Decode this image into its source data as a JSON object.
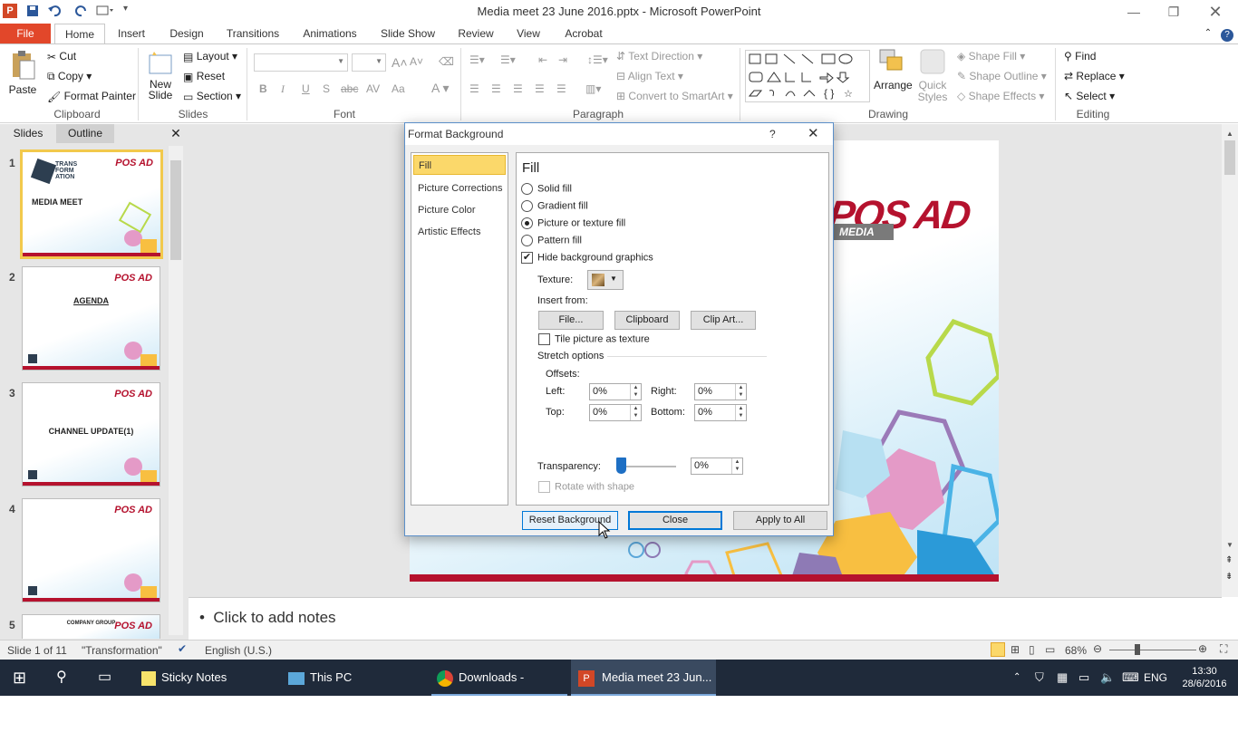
{
  "window": {
    "title": "Media meet  23 June 2016.pptx - Microsoft PowerPoint",
    "app_icon": "powerpoint-icon"
  },
  "tabs": [
    "File",
    "Home",
    "Insert",
    "Design",
    "Transitions",
    "Animations",
    "Slide Show",
    "Review",
    "View",
    "Acrobat"
  ],
  "ribbon": {
    "clipboard": {
      "paste": "Paste",
      "cut": "Cut",
      "copy": "Copy",
      "format_painter": "Format Painter",
      "label": "Clipboard"
    },
    "slides": {
      "new_slide_1": "New",
      "new_slide_2": "Slide",
      "layout": "Layout",
      "reset": "Reset",
      "section": "Section",
      "label": "Slides"
    },
    "font": {
      "label": "Font",
      "bold": "B",
      "italic": "I",
      "underline": "U",
      "strike": "abc",
      "shadow": "S"
    },
    "paragraph": {
      "text_direction": "Text Direction",
      "align_text": "Align Text",
      "convert_smartart": "Convert to SmartArt",
      "label": "Paragraph"
    },
    "drawing": {
      "arrange": "Arrange",
      "quick_styles_1": "Quick",
      "quick_styles_2": "Styles",
      "shape_fill": "Shape Fill",
      "shape_outline": "Shape Outline",
      "shape_effects": "Shape Effects",
      "label": "Drawing"
    },
    "editing": {
      "find": "Find",
      "replace": "Replace",
      "select": "Select",
      "label": "Editing"
    }
  },
  "left_pane": {
    "tabs": [
      "Slides",
      "Outline"
    ],
    "thumbnails": [
      {
        "num": "1",
        "title": "MEDIA MEET",
        "sub": "TRANS FORM ATION",
        "logo": "POS AD"
      },
      {
        "num": "2",
        "title": "AGENDA",
        "logo": "POS AD"
      },
      {
        "num": "3",
        "title": "CHANNEL UPDATE(1)",
        "logo": "POS AD"
      },
      {
        "num": "4",
        "title": "",
        "logo": "POS AD"
      },
      {
        "num": "5",
        "title": "COMPANY GROUP",
        "logo": "POS AD"
      }
    ]
  },
  "slide": {
    "logo_main": "POS AD",
    "logo_sub": "MEDIA"
  },
  "notes": {
    "placeholder": "Click to add notes"
  },
  "dialog": {
    "title": "Format Background",
    "help": "?",
    "nav": [
      "Fill",
      "Picture Corrections",
      "Picture Color",
      "Artistic Effects"
    ],
    "heading": "Fill",
    "options": {
      "solid_fill": "Solid fill",
      "gradient_fill": "Gradient fill",
      "picture_fill": "Picture or texture fill",
      "pattern_fill": "Pattern fill",
      "hide_bg": "Hide background graphics"
    },
    "selected_option": "picture_fill",
    "texture_label": "Texture:",
    "insert_from_label": "Insert from:",
    "file_btn": "File...",
    "clipboard_btn": "Clipboard",
    "clipart_btn": "Clip Art...",
    "tile_label": "Tile picture as texture",
    "stretch_label": "Stretch options",
    "offsets_label": "Offsets:",
    "left_label": "Left:",
    "left_val": "0%",
    "right_label": "Right:",
    "right_val": "0%",
    "top_label": "Top:",
    "top_val": "0%",
    "bottom_label": "Bottom:",
    "bottom_val": "0%",
    "transparency_label": "Transparency:",
    "transparency_val": "0%",
    "transparency_level": 0,
    "rotate_label": "Rotate with shape",
    "reset_btn": "Reset Background",
    "close_btn": "Close",
    "apply_all_btn": "Apply to All"
  },
  "status": {
    "slide_info": "Slide 1 of 11",
    "theme": "\"Transformation\"",
    "language": "English (U.S.)",
    "zoom": "68%"
  },
  "taskbar": {
    "apps": [
      "Sticky Notes",
      "This PC",
      "Downloads - Googl...",
      "Media meet  23 Jun..."
    ],
    "lang": "ENG",
    "time": "13:30",
    "date": "28/6/2016"
  },
  "colors": {
    "file_tab": "#e2472a",
    "accent_red": "#b5122e",
    "taskbar": "#1f2a3a",
    "selection": "#fbd86a"
  }
}
